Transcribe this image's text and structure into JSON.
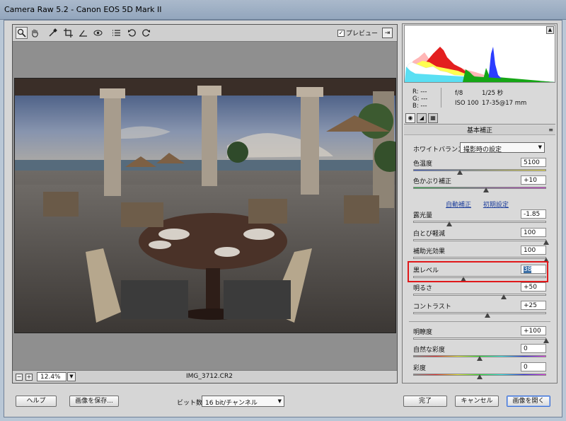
{
  "window": {
    "title": "Camera Raw 5.2  -  Canon EOS 5D Mark II"
  },
  "toolbar": {
    "tools": [
      "zoom-icon",
      "hand-icon",
      "eyedropper-icon",
      "crop-icon",
      "straighten-icon",
      "red-eye-icon",
      "preferences-icon",
      "rotate-left-icon",
      "rotate-right-icon"
    ],
    "preview_label": "プレビュー",
    "preview_checked": true
  },
  "status": {
    "zoom_minus": "−",
    "zoom_plus": "+",
    "zoom_value": "12.4%",
    "filename": "IMG_3712.CR2"
  },
  "info": {
    "r": "R:  ---",
    "g": "G:  ---",
    "b": "B:  ---",
    "aperture": "f/8",
    "shutter": "1/25 秒",
    "iso": "ISO 100",
    "lens": "17-35@17 mm"
  },
  "panel": {
    "header": "基本補正",
    "wb_label": "ホワイトバランス：",
    "wb_value": "撮影時の設定",
    "auto_link": "自動補正",
    "default_link": "初期設定",
    "sliders": {
      "temperature": {
        "label": "色温度",
        "value": "5100",
        "pos": 0.35
      },
      "tint": {
        "label": "色かぶり補正",
        "value": "+10",
        "pos": 0.55
      },
      "exposure": {
        "label": "露光量",
        "value": "-1.85",
        "pos": 0.27
      },
      "recovery": {
        "label": "白とび軽減",
        "value": "100",
        "pos": 1.0
      },
      "fill": {
        "label": "補助光効果",
        "value": "100",
        "pos": 1.0
      },
      "blacks": {
        "label": "黒レベル",
        "value": "38",
        "pos": 0.38
      },
      "brightness": {
        "label": "明るさ",
        "value": "+50",
        "pos": 0.68
      },
      "contrast": {
        "label": "コントラスト",
        "value": "+25",
        "pos": 0.56
      },
      "clarity": {
        "label": "明瞭度",
        "value": "+100",
        "pos": 1.0
      },
      "vibrance": {
        "label": "自然な彩度",
        "value": "0",
        "pos": 0.5
      },
      "saturation": {
        "label": "彩度",
        "value": "0",
        "pos": 0.5
      }
    }
  },
  "bottom": {
    "help": "ヘルプ",
    "save": "画像を保存...",
    "bit_label": "ビット数：",
    "bit_value": "16 bit/チャンネル",
    "done": "完了",
    "cancel": "キャンセル",
    "open": "画像を開く"
  },
  "colors": {
    "accent_link": "#1d3e9c",
    "highlight_border": "#e0181a",
    "selection": "#3a6ea5"
  }
}
